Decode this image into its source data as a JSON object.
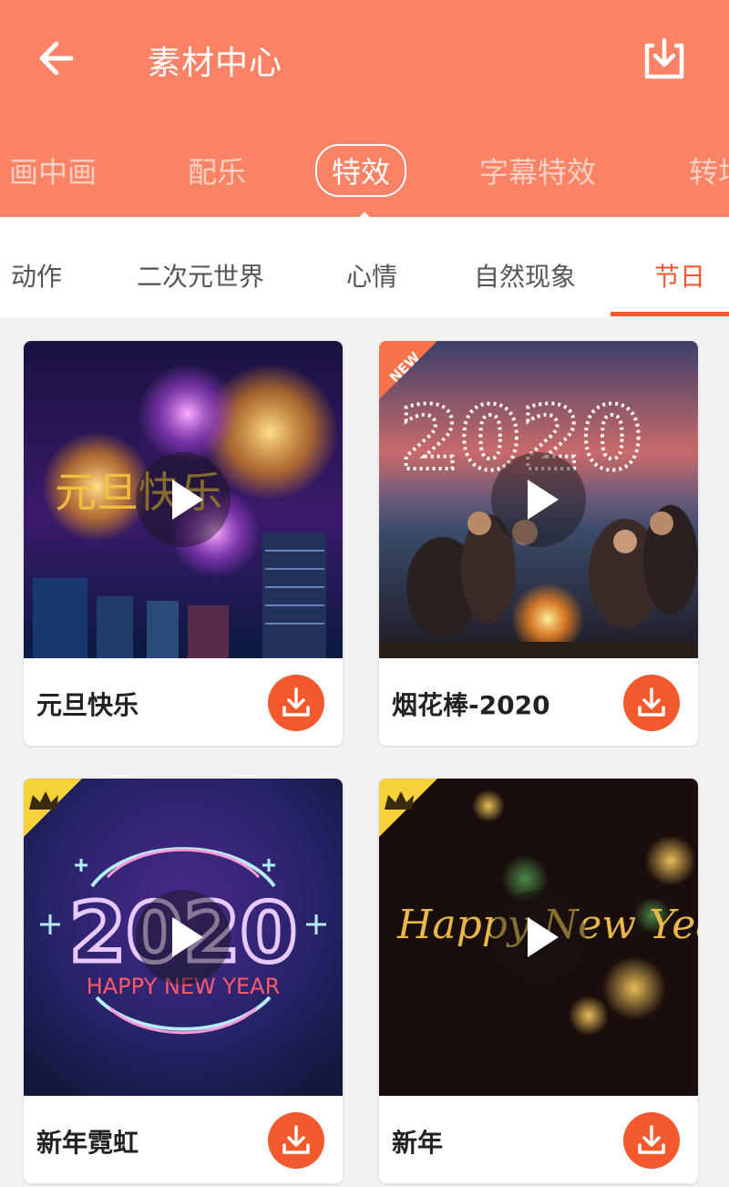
{
  "header": {
    "title": "素材中心",
    "back_icon": "arrow-left-icon",
    "download_icon": "download-box-icon"
  },
  "colors": {
    "header_bg": "#fa8366",
    "accent": "#f25a2e",
    "download_btn": "#f2592c"
  },
  "top_tabs": [
    {
      "label": "画中画",
      "active": false
    },
    {
      "label": "配乐",
      "active": false
    },
    {
      "label": "特效",
      "active": true
    },
    {
      "label": "字幕特效",
      "active": false
    },
    {
      "label": "转场",
      "active": false
    }
  ],
  "sub_tabs": [
    {
      "label": "动作",
      "active": false
    },
    {
      "label": "二次元世界",
      "active": false
    },
    {
      "label": "心情",
      "active": false
    },
    {
      "label": "自然现象",
      "active": false
    },
    {
      "label": "节日",
      "active": true
    }
  ],
  "cards": [
    {
      "title": "元旦快乐",
      "overlay_text": "元旦快乐",
      "badge": "",
      "badge_icon": ""
    },
    {
      "title": "烟花棒-2020",
      "overlay_text": "2020",
      "badge": "NEW",
      "badge_icon": ""
    },
    {
      "title": "新年霓虹",
      "overlay_text": "2020",
      "overlay_sub": "HAPPY NEW YEAR",
      "badge": "",
      "badge_icon": "crown-icon"
    },
    {
      "title": "新年",
      "overlay_text": "Happy New Year",
      "badge": "",
      "badge_icon": "crown-icon"
    }
  ]
}
